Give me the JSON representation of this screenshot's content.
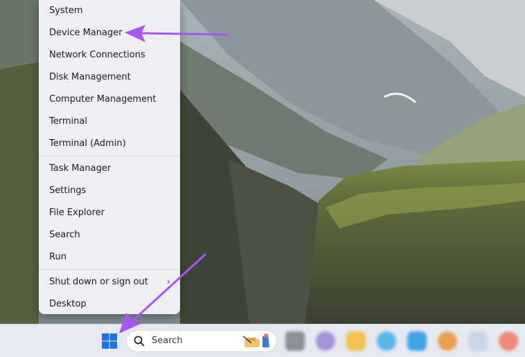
{
  "menu": {
    "items": [
      {
        "label": "System"
      },
      {
        "label": "Device Manager"
      },
      {
        "label": "Network Connections"
      },
      {
        "label": "Disk Management"
      },
      {
        "label": "Computer Management"
      },
      {
        "label": "Terminal"
      },
      {
        "label": "Terminal (Admin)"
      },
      {
        "label": "Task Manager"
      },
      {
        "label": "Settings"
      },
      {
        "label": "File Explorer"
      },
      {
        "label": "Search"
      },
      {
        "label": "Run"
      },
      {
        "label": "Shut down or sign out",
        "submenu_indicator": "›"
      },
      {
        "label": "Desktop"
      }
    ]
  },
  "taskbar": {
    "search_label": "Search",
    "start_icon": "windows-logo-icon",
    "accent": "#1a73e8"
  },
  "annotations": {
    "arrow_color": "#a855f7"
  }
}
